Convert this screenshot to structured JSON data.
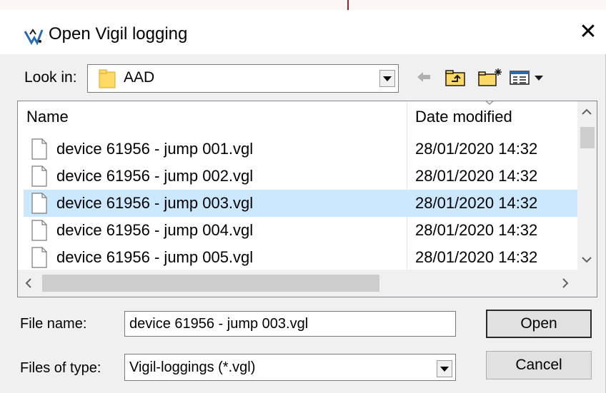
{
  "dialog": {
    "title": "Open Vigil logging",
    "app_icon": "vigil-app-icon",
    "close_glyph": "✕"
  },
  "lookin": {
    "label": "Look in:",
    "value": "AAD",
    "folder_icon": "folder-icon"
  },
  "toolbar": {
    "icons": [
      "back-arrow-icon",
      "up-one-level-icon",
      "create-new-folder-icon",
      "view-menu-icon"
    ]
  },
  "list": {
    "columns": [
      "Name",
      "Date modified"
    ],
    "files": [
      {
        "name": "device 61956 - jump 001.vgl",
        "date": "28/01/2020 14:32",
        "selected": false
      },
      {
        "name": "device 61956 - jump 002.vgl",
        "date": "28/01/2020 14:32",
        "selected": false
      },
      {
        "name": "device 61956 - jump 003.vgl",
        "date": "28/01/2020 14:32",
        "selected": true
      },
      {
        "name": "device 61956 - jump 004.vgl",
        "date": "28/01/2020 14:32",
        "selected": false
      },
      {
        "name": "device 61956 - jump 005.vgl",
        "date": "28/01/2020 14:32",
        "selected": false
      }
    ]
  },
  "filename": {
    "label": "File name:",
    "value": "device 61956 - jump 003.vgl"
  },
  "filetype": {
    "label": "Files of type:",
    "value": "Vigil-loggings (*.vgl)"
  },
  "buttons": {
    "open": "Open",
    "cancel": "Cancel"
  },
  "colors": {
    "selection": "#cce8ff",
    "dialog_bg": "#f0f0f0",
    "folder": "#ffd966"
  }
}
